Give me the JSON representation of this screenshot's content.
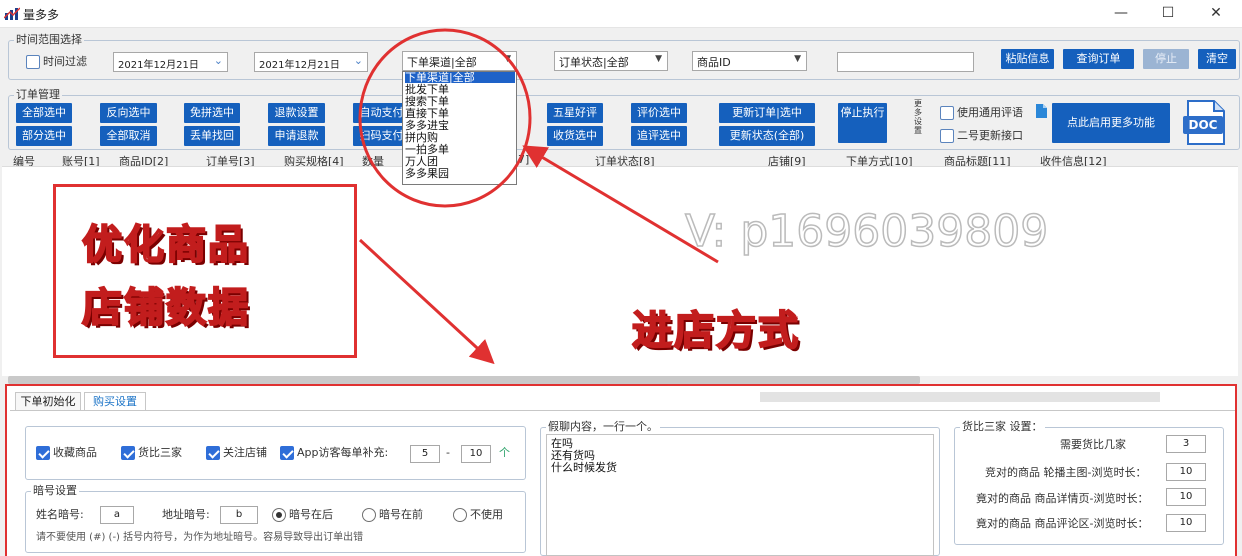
{
  "window": {
    "title": "量多多"
  },
  "time_group": {
    "label": "时间范围选择",
    "filter_label": "时间过滤",
    "start_date": "2021年12月21日",
    "end_date": "2021年12月21日"
  },
  "filters": {
    "channel_value": "下单渠道|全部",
    "order_status_value": "订单状态|全部",
    "product_id_value": "商品ID"
  },
  "channel_options": [
    "下单渠道|全部",
    "批发下单",
    "搜索下单",
    "直接下单",
    "多多进宝",
    "拼内购",
    "一拍多单",
    "万人团",
    "多多果园"
  ],
  "top_buttons": {
    "paste": "粘贴信息",
    "query": "查询订单",
    "stop": "停止",
    "clear": "清空"
  },
  "order_group": {
    "label": "订单管理",
    "row1": [
      "全部选中",
      "反向选中",
      "免拼选中",
      "退款设置",
      "自动支付",
      "五星好评",
      "评价选中",
      "更新订单|选中"
    ],
    "row2": [
      "部分选中",
      "全部取消",
      "丢单找回",
      "申请退款",
      "扫码支付",
      "收货选中",
      "追评选中",
      "更新状态(全部)"
    ],
    "stop_exec": "停止执行",
    "more_settings": "更多设置",
    "use_common_review": "使用通用评语",
    "second_update": "二号更新接口",
    "enable_more": "点此启用更多功能",
    "doc_label": "DOC"
  },
  "columns": [
    "编号",
    "账号[1]",
    "商品ID[2]",
    "订单号[3]",
    "购买规格[4]",
    "数量",
    "订单状态[8]",
    "店铺[9]",
    "下单方式[10]",
    "商品标题[11]",
    "收件信息[12]"
  ],
  "col7_fragment": "7]",
  "overlays": {
    "promo_line1": "优化商品",
    "promo_line2": "店铺数据",
    "entry_label": "进店方式",
    "watermark": "V: p1696039809"
  },
  "tabs": [
    "下单初始化",
    "购买设置"
  ],
  "purchase": {
    "collect": "收藏商品",
    "compare3": "货比三家",
    "follow_shop": "关注店铺",
    "app_visit": "App访客每单补充:",
    "app_min": "5",
    "dash": "-",
    "app_max": "10",
    "unit": "个"
  },
  "code_group": {
    "label": "暗号设置",
    "name_code_label": "姓名暗号:",
    "name_code": "a",
    "addr_code_label": "地址暗号:",
    "addr_code": "b",
    "after": "暗号在后",
    "before": "暗号在前",
    "none": "不使用",
    "hint": "请不要使用 (#) (-) 括号内符号，为作为地址暗号。容易导致导出订单出错"
  },
  "fake_chat": {
    "label": "假聊内容，一行一个。",
    "lines": [
      "在吗",
      "还有货吗",
      "什么时候发货"
    ]
  },
  "compare_group": {
    "label": "货比三家 设置：",
    "need_label": "需要货比几家",
    "need": "3",
    "row1_label": "竞对的商品 轮播主图-浏览时长：",
    "row1": "10",
    "row2_label": "竟对的商品 商品详情页-浏览时长：",
    "row2": "10",
    "row3_label": "竟对的商品 商品评论区-浏览时长：",
    "row3": "10"
  },
  "colors": {
    "accent": "#1560bd",
    "annotation": "#e03131"
  }
}
